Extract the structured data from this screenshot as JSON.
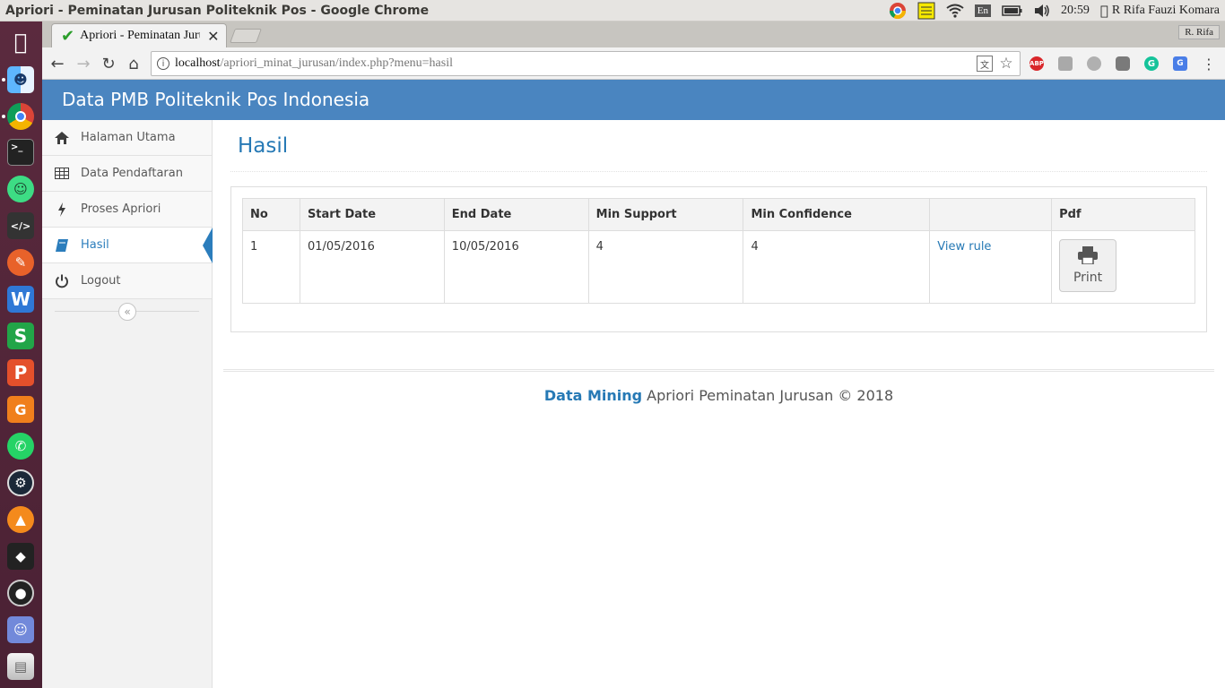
{
  "os": {
    "window_title": "Apriori - Peminatan Jurusan Politeknik Pos - Google Chrome",
    "language": "En",
    "clock": "20:59",
    "user": "R Rifa Fauzi Komara"
  },
  "browser": {
    "tab_title": "Apriori - Peminatan Jurusan Politeknik Pos",
    "profile": "R. Rifa",
    "url_host": "localhost",
    "url_path": "/apriori_minat_jurusan/index.php?menu=hasil"
  },
  "launcher": {
    "icons": [
      "apple-icon",
      "finder-icon",
      "chrome-icon",
      "terminal-icon",
      "android-icon",
      "code-editor-icon",
      "compass-icon",
      "wps-writer-icon",
      "wps-spreadsheet-icon",
      "wps-presentation-icon",
      "wps-pdf-icon",
      "whatsapp-icon",
      "steam-icon",
      "vlc-icon",
      "inkscape-icon",
      "obs-icon",
      "discord-icon",
      "trash-icon"
    ]
  },
  "app": {
    "brand": "Data PMB Politeknik Pos Indonesia",
    "colors": {
      "navbar": "#4a85c0",
      "accent": "#2679b5"
    }
  },
  "sidebar": {
    "items": [
      {
        "label": "Halaman Utama",
        "icon": "home-icon"
      },
      {
        "label": "Data Pendaftaran",
        "icon": "table-icon"
      },
      {
        "label": "Proses Apriori",
        "icon": "bolt-icon"
      },
      {
        "label": "Hasil",
        "icon": "book-icon",
        "active": true
      },
      {
        "label": "Logout",
        "icon": "power-icon"
      }
    ],
    "collapse_glyph": "«"
  },
  "main": {
    "title": "Hasil",
    "table": {
      "headers": [
        "No",
        "Start Date",
        "End Date",
        "Min Support",
        "Min Confidence",
        "",
        "Pdf"
      ],
      "rows": [
        {
          "no": "1",
          "start_date": "01/05/2016",
          "end_date": "10/05/2016",
          "min_support": "4",
          "min_confidence": "4",
          "view_rule": "View rule",
          "print_label": "Print"
        }
      ]
    }
  },
  "footer": {
    "brand": "Data Mining",
    "text": " Apriori Peminatan Jurusan © 2018"
  }
}
